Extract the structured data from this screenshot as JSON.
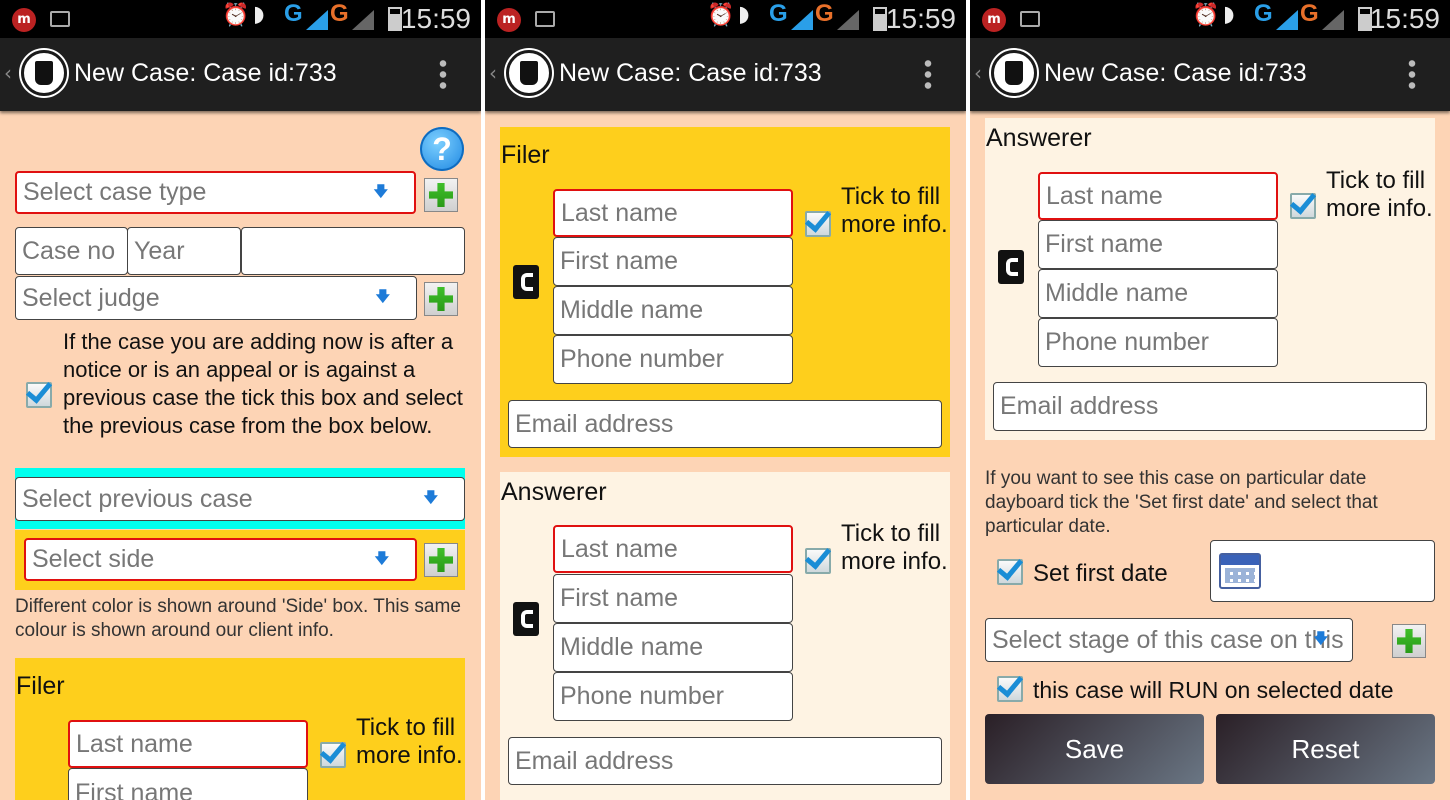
{
  "status_bar": {
    "time": "15:59",
    "net1": "G",
    "net2": "G"
  },
  "action_bar": {
    "title": "New Case: Case id:733"
  },
  "screen1": {
    "case_type_placeholder": "Select case type",
    "case_no_placeholder": "Case no",
    "year_placeholder": "Year",
    "judge_placeholder": "Select judge",
    "appeal_note": "If the case you are adding now is after a notice or is an appeal or is against a previous case the tick this box and select the previous case from the box below.",
    "previous_case_placeholder": "Select previous case",
    "side_placeholder": "Select side",
    "side_note": "Different color is shown around 'Side' box. This same colour is shown around our client info.",
    "filer": {
      "title": "Filer",
      "last_name": "Last name",
      "first_name": "First name",
      "tick_label": "Tick to fill more info."
    }
  },
  "screen2": {
    "filer": {
      "title": "Filer",
      "last_name": "Last name",
      "first_name": "First name",
      "middle_name": "Middle name",
      "phone": "Phone number",
      "email": "Email address",
      "tick_label": "Tick to fill more info."
    },
    "answerer": {
      "title": "Answerer",
      "last_name": "Last name",
      "first_name": "First name",
      "middle_name": "Middle name",
      "phone": "Phone number",
      "email": "Email address",
      "tick_label": "Tick to fill more info."
    }
  },
  "screen3": {
    "answerer": {
      "title": "Answerer",
      "last_name": "Last name",
      "first_name": "First name",
      "middle_name": "Middle name",
      "phone": "Phone number",
      "email": "Email address",
      "tick_label": "Tick to fill more info."
    },
    "dayboard_note": "If you want to see this case on particular date dayboard tick the 'Set first date' and select that particular date.",
    "set_first_date_label": "Set first date",
    "stage_placeholder": "Select stage of this case on this",
    "run_label": "this case will RUN on selected date",
    "save_label": "Save",
    "reset_label": "Reset"
  },
  "colors": {
    "page_bg": "#fdd4b5",
    "filer_bg": "#fecf1c",
    "answerer_bg": "#fef3e3",
    "previous_case_border": "#00ffee",
    "required_border": "#e01010"
  }
}
